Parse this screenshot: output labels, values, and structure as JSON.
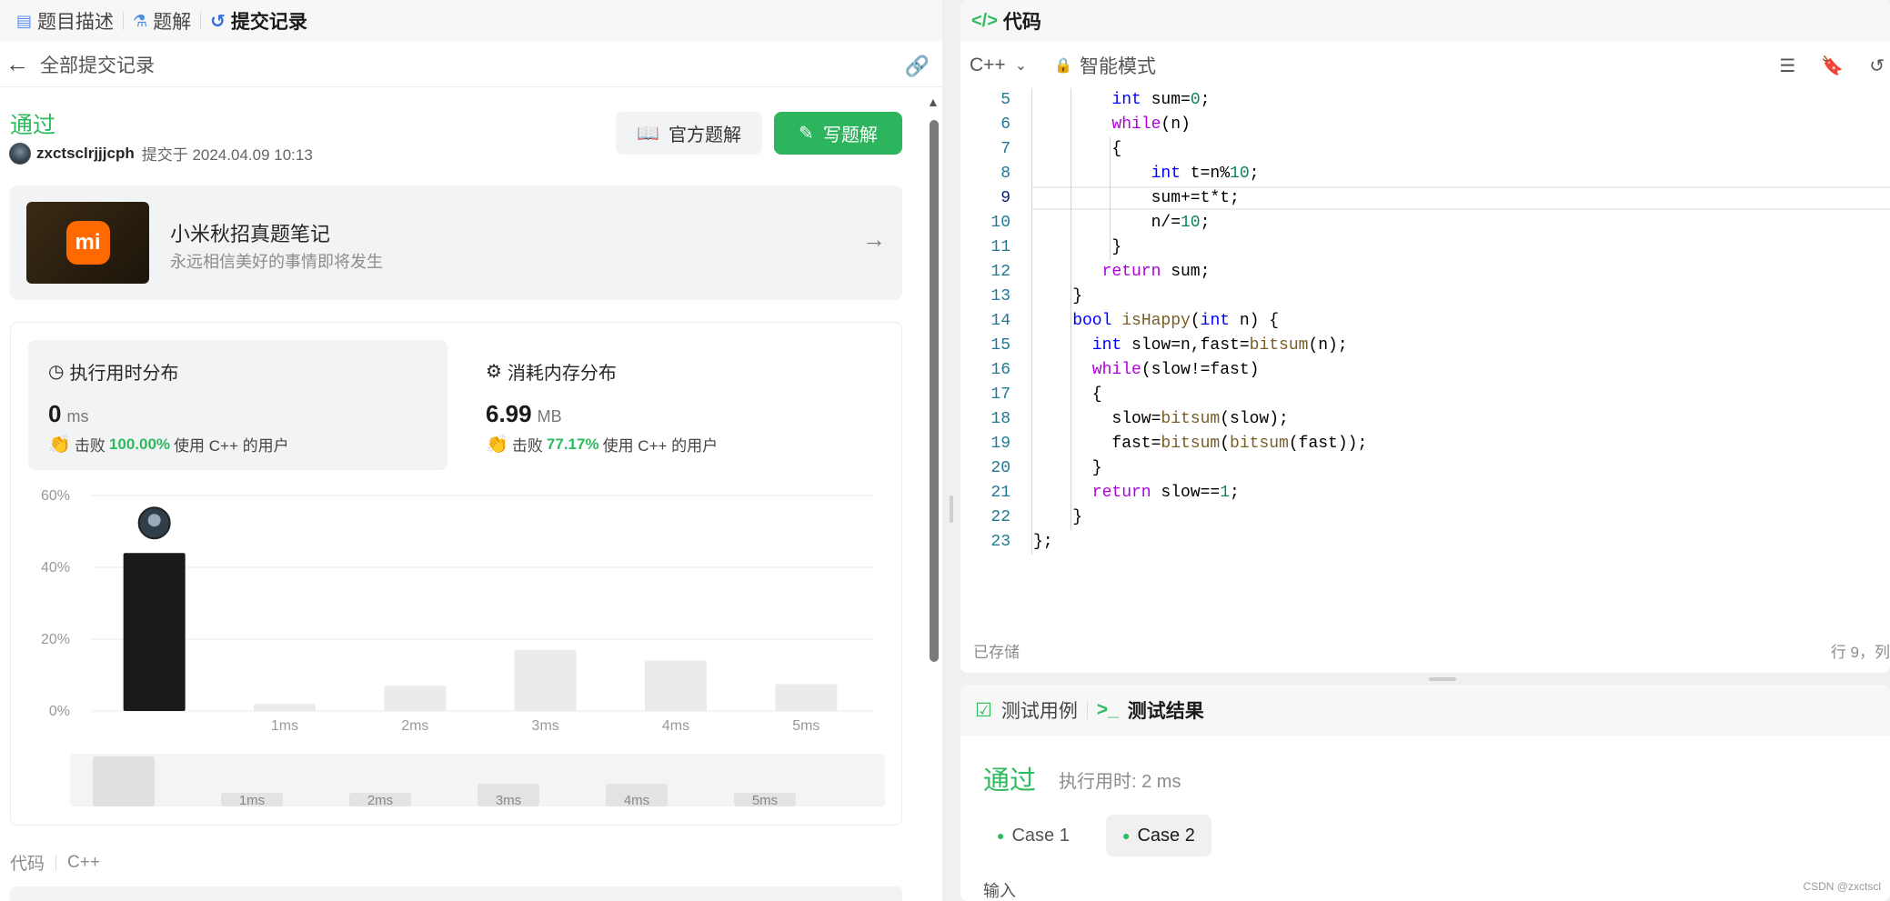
{
  "left": {
    "tabs": [
      {
        "label": "题目描述",
        "icon": "document-icon"
      },
      {
        "label": "题解",
        "icon": "flask-icon"
      },
      {
        "label": "提交记录",
        "icon": "history-icon"
      }
    ],
    "back_label": "全部提交记录",
    "status": "通过",
    "username": "zxctsclrjjjcph",
    "submitted_at": "提交于 2024.04.09 10:13",
    "official_solution_label": "官方题解",
    "write_solution_label": "写题解",
    "banner": {
      "logo": "mi",
      "title": "小米秋招真题笔记",
      "subtitle": "永远相信美好的事情即将发生"
    },
    "runtime": {
      "title": "执行用时分布",
      "value": "0",
      "unit": "ms",
      "beat_prefix": "击败",
      "beat_pct": "100.00%",
      "beat_suffix": "使用 C++ 的用户"
    },
    "memory": {
      "title": "消耗内存分布",
      "value": "6.99",
      "unit": "MB",
      "beat_prefix": "击败",
      "beat_pct": "77.17%",
      "beat_suffix": "使用 C++ 的用户"
    },
    "code_label": "代码",
    "code_lang": "C++"
  },
  "chart_data": {
    "type": "bar",
    "categories": [
      "0ms",
      "1ms",
      "2ms",
      "3ms",
      "4ms",
      "5ms"
    ],
    "category_tick_labels": [
      "",
      "1ms",
      "2ms",
      "3ms",
      "4ms",
      "5ms"
    ],
    "values": [
      44,
      2,
      7,
      17,
      14,
      7.5
    ],
    "highlighted_category": "0ms",
    "ylim": [
      0,
      60
    ],
    "yticks": [
      "0%",
      "20%",
      "40%",
      "60%"
    ],
    "ytick_values": [
      0,
      20,
      40,
      60
    ],
    "grid": true,
    "highlight_color": "#1a1a1a",
    "bar_color": "#ebebeb",
    "overview_values": [
      11,
      3,
      3,
      5,
      5,
      3
    ],
    "overview_ticks": [
      "1ms",
      "2ms",
      "3ms",
      "4ms",
      "5ms"
    ]
  },
  "right": {
    "title": "代码",
    "lang": "C++",
    "mode": "智能模式",
    "code_lines": [
      {
        "n": "5",
        "html": "<span class='kw'>int</span> sum=<span class='num'>0</span>;",
        "indent": 8
      },
      {
        "n": "6",
        "html": "<span class='ctl'>while</span>(n)",
        "indent": 8
      },
      {
        "n": "7",
        "html": "{",
        "indent": 8
      },
      {
        "n": "8",
        "html": "<span class='kw'>int</span> t=n%<span class='num'>10</span>;",
        "indent": 12
      },
      {
        "n": "9",
        "html": "sum+=t*t;",
        "indent": 12
      },
      {
        "n": "10",
        "html": "n/=<span class='num'>10</span>;",
        "indent": 12
      },
      {
        "n": "11",
        "html": "}",
        "indent": 8
      },
      {
        "n": "12",
        "html": "<span class='ctl'>return</span> sum;",
        "indent": 7
      },
      {
        "n": "13",
        "html": "}",
        "indent": 4
      },
      {
        "n": "14",
        "html": "<span class='kw'>bool</span> <span class='fn'>isHappy</span>(<span class='kw'>int</span> n) {",
        "indent": 4
      },
      {
        "n": "15",
        "html": "<span class='kw'>int</span> slow=n,fast=<span class='fn'>bitsum</span>(n);",
        "indent": 6
      },
      {
        "n": "16",
        "html": "<span class='ctl'>while</span>(slow!=fast)",
        "indent": 6
      },
      {
        "n": "17",
        "html": "{",
        "indent": 6
      },
      {
        "n": "18",
        "html": "slow=<span class='fn'>bitsum</span>(slow);",
        "indent": 8
      },
      {
        "n": "19",
        "html": "fast=<span class='fn'>bitsum</span>(<span class='fn'>bitsum</span>(fast));",
        "indent": 8
      },
      {
        "n": "20",
        "html": "}",
        "indent": 6
      },
      {
        "n": "21",
        "html": "<span class='ctl'>return</span> slow==<span class='num'>1</span>;",
        "indent": 6
      },
      {
        "n": "22",
        "html": "}",
        "indent": 4
      },
      {
        "n": "23",
        "html": "};",
        "indent": 0
      }
    ],
    "current_line": "9",
    "saved_label": "已存储",
    "cursor_pos": "行 9，列",
    "test_tabs": [
      {
        "label": "测试用例",
        "icon": "checkbox-icon"
      },
      {
        "label": "测试结果",
        "icon": "terminal-icon"
      }
    ],
    "result_status": "通过",
    "exec_time": "执行用时: 2 ms",
    "cases": [
      "Case 1",
      "Case 2"
    ],
    "selected_case": 1,
    "input_label": "输入"
  },
  "watermark": "CSDN @zxctscl"
}
